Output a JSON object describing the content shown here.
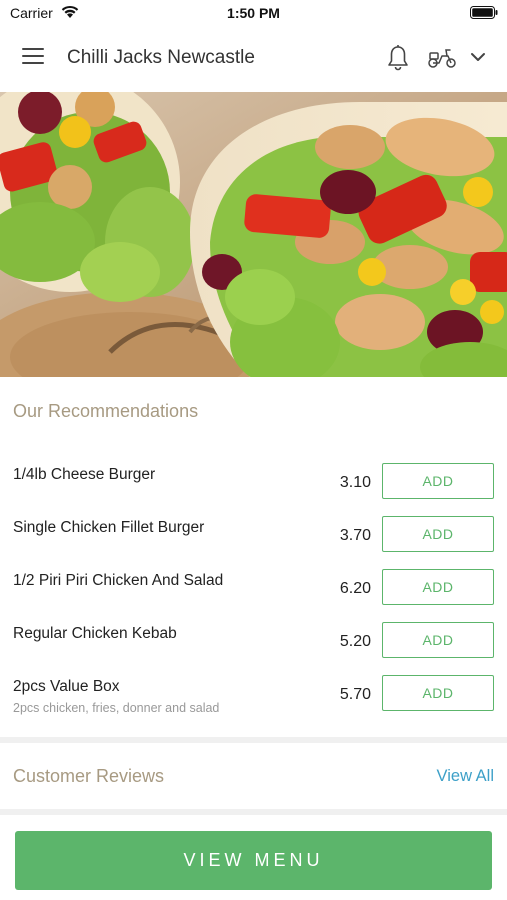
{
  "status_bar": {
    "carrier": "Carrier",
    "time": "1:50 PM"
  },
  "header": {
    "title": "Chilli Jacks Newcastle",
    "icons": [
      "menu-icon",
      "bell-icon",
      "scooter-icon",
      "chevron-down-icon"
    ]
  },
  "recommendations": {
    "title": "Our Recommendations",
    "items": [
      {
        "name": "1/4lb Cheese Burger",
        "description": "",
        "price": "3.10",
        "button": "ADD"
      },
      {
        "name": "Single Chicken Fillet Burger",
        "description": "",
        "price": "3.70",
        "button": "ADD"
      },
      {
        "name": "1/2 Piri Piri Chicken And Salad",
        "description": "",
        "price": "6.20",
        "button": "ADD"
      },
      {
        "name": "Regular Chicken Kebab",
        "description": "",
        "price": "5.20",
        "button": "ADD"
      },
      {
        "name": "2pcs Value Box",
        "description": "2pcs chicken, fries, donner and salad",
        "price": "5.70",
        "button": "ADD"
      }
    ]
  },
  "reviews": {
    "title": "Customer Reviews",
    "view_all": "View All"
  },
  "footer": {
    "button": "VIEW MENU"
  },
  "colors": {
    "accent_green": "#5cb56b",
    "section_title": "#a79a82",
    "link_blue": "#3da0c8"
  }
}
